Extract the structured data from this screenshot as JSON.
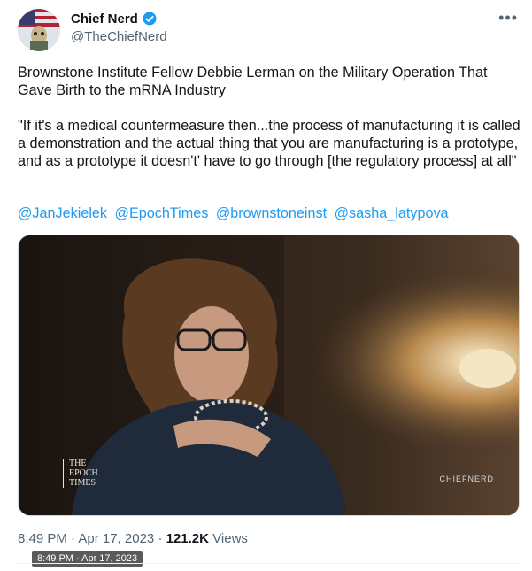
{
  "author": {
    "name": "Chief Nerd",
    "handle": "@TheChiefNerd",
    "verified_color": "#1d9bf0"
  },
  "tweet": {
    "paragraph1": "Brownstone Institute Fellow Debbie Lerman on the Military Operation That Gave Birth to the mRNA Industry",
    "paragraph2": "\"If it's a medical countermeasure then...the process of manufacturing it is called a demonstration and the actual thing that you are manufacturing is a prototype, and as a prototype it doesn't' have to go through [the regulatory process] at all\"",
    "mentions": [
      "@JanJekielek",
      "@EpochTimes",
      "@brownstoneinst",
      "@sasha_latypova"
    ]
  },
  "media": {
    "watermark_left": [
      "THE",
      "EPOCH",
      "TIMES"
    ],
    "watermark_right": "CHIEFNERD"
  },
  "meta": {
    "time": "8:49 PM · Apr 17, 2023",
    "separator": "·",
    "views_count": "121.2K",
    "views_label": "Views"
  },
  "tooltip": "8:49 PM · Apr 17, 2023",
  "icons": {
    "more": "more-icon",
    "verified": "verified-badge-icon"
  },
  "colors": {
    "link": "#1d9bf0",
    "muted": "#536471",
    "text": "#0f1419"
  }
}
